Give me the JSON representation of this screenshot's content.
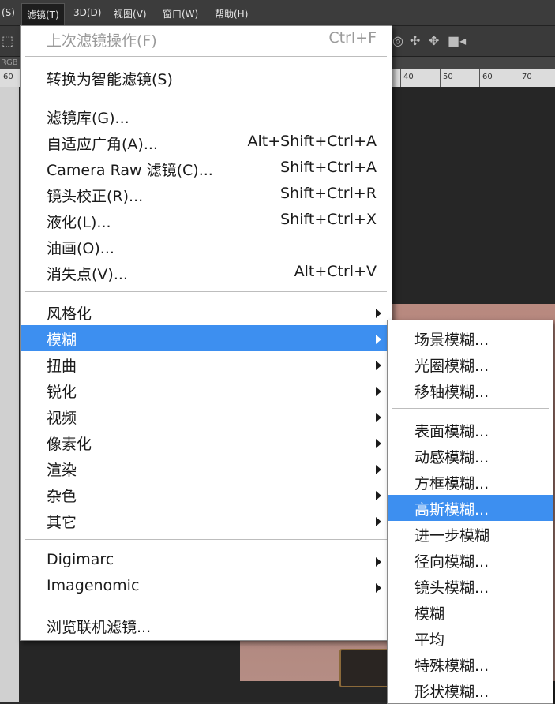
{
  "menubar": {
    "items": [
      {
        "label": "(S)"
      },
      {
        "label": "滤镜(T)"
      },
      {
        "label": "3D(D)"
      },
      {
        "label": "视图(V)"
      },
      {
        "label": "窗口(W)"
      },
      {
        "label": "帮助(H)"
      }
    ]
  },
  "doc": {
    "tab_label": "RGB",
    "ruler_labels": [
      "60",
      "40",
      "50",
      "60",
      "70"
    ]
  },
  "filter_menu": {
    "items": [
      {
        "label": "上次滤镜操作(F)",
        "shortcut": "Ctrl+F"
      },
      {
        "label": "转换为智能滤镜(S)"
      },
      {
        "label": "滤镜库(G)..."
      },
      {
        "label": "自适应广角(A)...",
        "shortcut": "Alt+Shift+Ctrl+A"
      },
      {
        "label": "Camera Raw 滤镜(C)...",
        "shortcut": "Shift+Ctrl+A"
      },
      {
        "label": "镜头校正(R)...",
        "shortcut": "Shift+Ctrl+R"
      },
      {
        "label": "液化(L)...",
        "shortcut": "Shift+Ctrl+X"
      },
      {
        "label": "油画(O)..."
      },
      {
        "label": "消失点(V)...",
        "shortcut": "Alt+Ctrl+V"
      },
      {
        "label": "风格化"
      },
      {
        "label": "模糊"
      },
      {
        "label": "扭曲"
      },
      {
        "label": "锐化"
      },
      {
        "label": "视频"
      },
      {
        "label": "像素化"
      },
      {
        "label": "渲染"
      },
      {
        "label": "杂色"
      },
      {
        "label": "其它"
      },
      {
        "label": "Digimarc"
      },
      {
        "label": "Imagenomic"
      },
      {
        "label": "浏览联机滤镜..."
      }
    ]
  },
  "blur_submenu": {
    "items": [
      {
        "label": "场景模糊..."
      },
      {
        "label": "光圈模糊..."
      },
      {
        "label": "移轴模糊..."
      },
      {
        "label": "表面模糊..."
      },
      {
        "label": "动感模糊..."
      },
      {
        "label": "方框模糊..."
      },
      {
        "label": "高斯模糊..."
      },
      {
        "label": "进一步模糊"
      },
      {
        "label": "径向模糊..."
      },
      {
        "label": "镜头模糊..."
      },
      {
        "label": "模糊"
      },
      {
        "label": "平均"
      },
      {
        "label": "特殊模糊..."
      },
      {
        "label": "形状模糊..."
      }
    ]
  },
  "colors": {
    "highlight": "#3d8ff0",
    "menu_bg": "#ffffff",
    "app_bg": "#2b2b2b"
  }
}
